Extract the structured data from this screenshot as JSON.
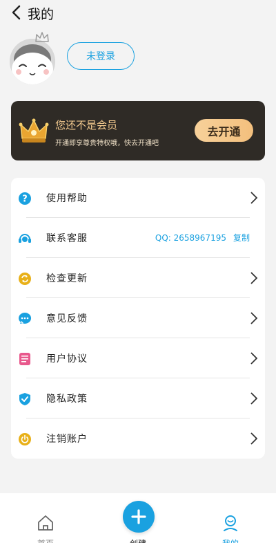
{
  "header": {
    "title": "我的"
  },
  "profile": {
    "login_label": "未登录"
  },
  "vip_banner": {
    "title": "您还不是会员",
    "subtitle": "开通即享尊贵特权哦，快去开通吧",
    "button": "去开通"
  },
  "menu": {
    "items": [
      {
        "label": "使用帮助",
        "icon": "help-icon"
      },
      {
        "label": "联系客服",
        "icon": "customer-service-icon",
        "qq_label": "QQ: 2658967195",
        "copy_label": "复制"
      },
      {
        "label": "检查更新",
        "icon": "update-icon"
      },
      {
        "label": "意见反馈",
        "icon": "feedback-icon"
      },
      {
        "label": "用户协议",
        "icon": "document-icon"
      },
      {
        "label": "隐私政策",
        "icon": "shield-icon"
      },
      {
        "label": "注销账户",
        "icon": "power-icon"
      }
    ]
  },
  "tabbar": {
    "tabs": [
      {
        "label": "首页"
      },
      {
        "label": "创建"
      },
      {
        "label": "我的"
      }
    ]
  },
  "colors": {
    "accent": "#1aa1e0",
    "vip_bg": "#2f2b26",
    "vip_gold": "#f2c98e"
  }
}
